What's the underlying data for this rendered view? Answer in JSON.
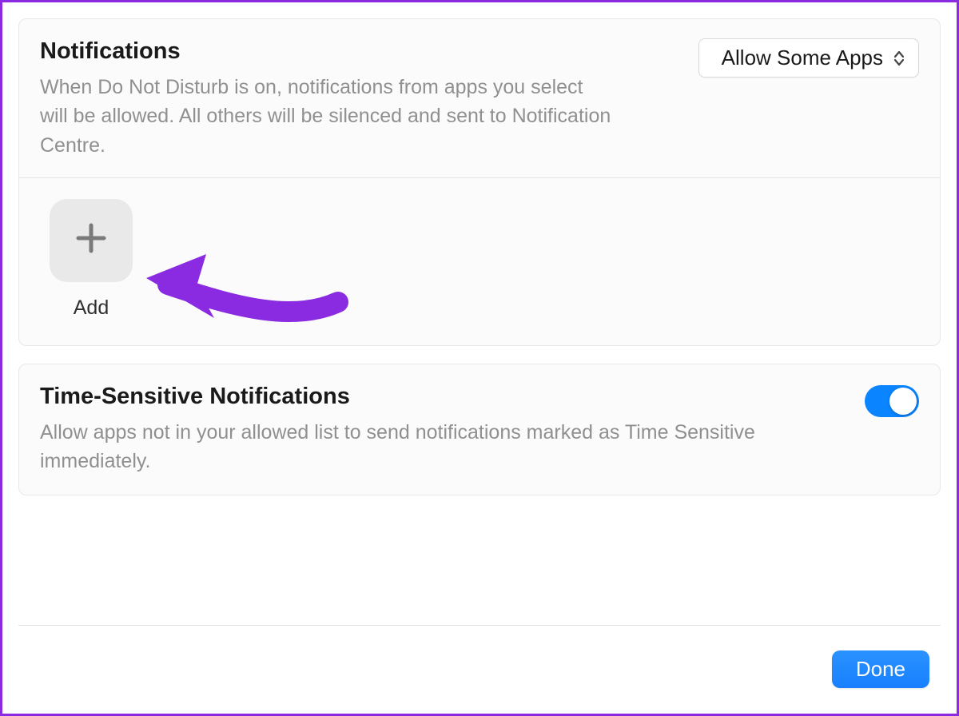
{
  "notifications": {
    "title": "Notifications",
    "description": "When Do Not Disturb is on, notifications from apps you select will be allowed. All others will be silenced and sent to Notification Centre.",
    "dropdown_value": "Allow Some Apps",
    "add_label": "Add"
  },
  "time_sensitive": {
    "title": "Time-Sensitive Notifications",
    "description": "Allow apps not in your allowed list to send notifications marked as Time Sensitive immediately.",
    "toggle_on": true
  },
  "footer": {
    "done_label": "Done"
  },
  "colors": {
    "accent_blue": "#0b84ff",
    "annotation_purple": "#8a2be2"
  }
}
